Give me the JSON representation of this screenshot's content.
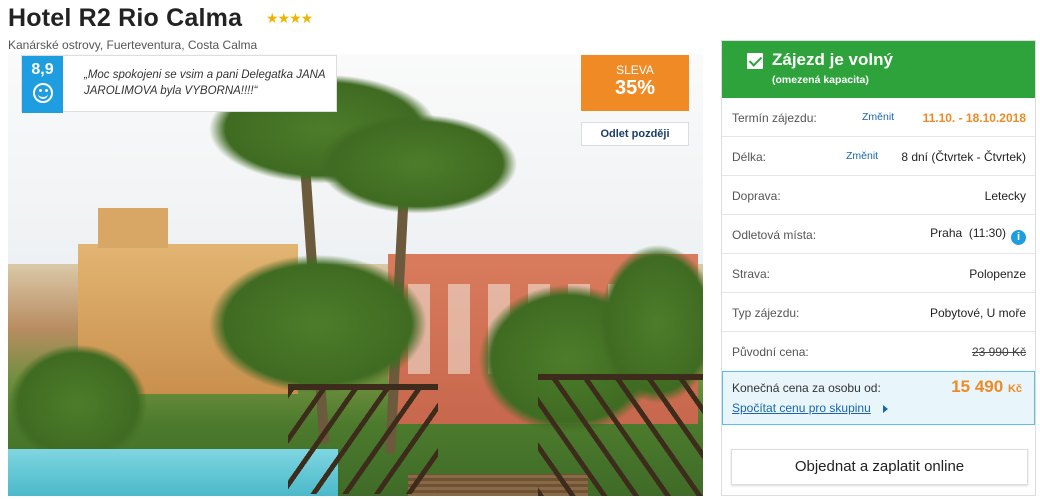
{
  "hotel": {
    "name": "Hotel R2 Rio Calma",
    "stars": "★★★★",
    "location": "Kanárské ostrovy, Fuerteventura, Costa Calma"
  },
  "review": {
    "score": "8,9",
    "icon": "smiley-icon",
    "quote": "„Moc spokojeni se vsim a pani Delegatka JANA JAROLIMOVA byla VYBORNA!!!!“"
  },
  "discount": {
    "label": "SLEVA",
    "value": "35%"
  },
  "later_departure": "Odlet později",
  "status": {
    "title": "Zájezd je volný",
    "subtitle": "(omezená kapacita)"
  },
  "rows": [
    {
      "label": "Termín zájezdu:",
      "change": "Změnit",
      "value": "11.10. - 18.10.2018"
    },
    {
      "label": "Délka:",
      "change": "Změnit",
      "value": "8 dní (Čtvrtek - Čtvrtek)"
    },
    {
      "label": "Doprava:",
      "value": "Letecky"
    },
    {
      "label": "Odletová místa:",
      "value": "Praha  (11:30)"
    },
    {
      "label": "Strava:",
      "value": "Polopenze"
    },
    {
      "label": "Typ zájezdu:",
      "value": "Pobytové, U moře"
    },
    {
      "label": "Původní cena:",
      "value": "23 990 Kč"
    }
  ],
  "final": {
    "label": "Konečná cena za osobu od:",
    "price": "15 490",
    "currency": "Kč",
    "group_link": "Spočítat cenu pro skupinu"
  },
  "order_button": "Objednat a zaplatit online",
  "colors": {
    "green": "#2ea33b",
    "orange": "#f08a24",
    "blue": "#1e9ee0",
    "star": "#f0b400"
  }
}
